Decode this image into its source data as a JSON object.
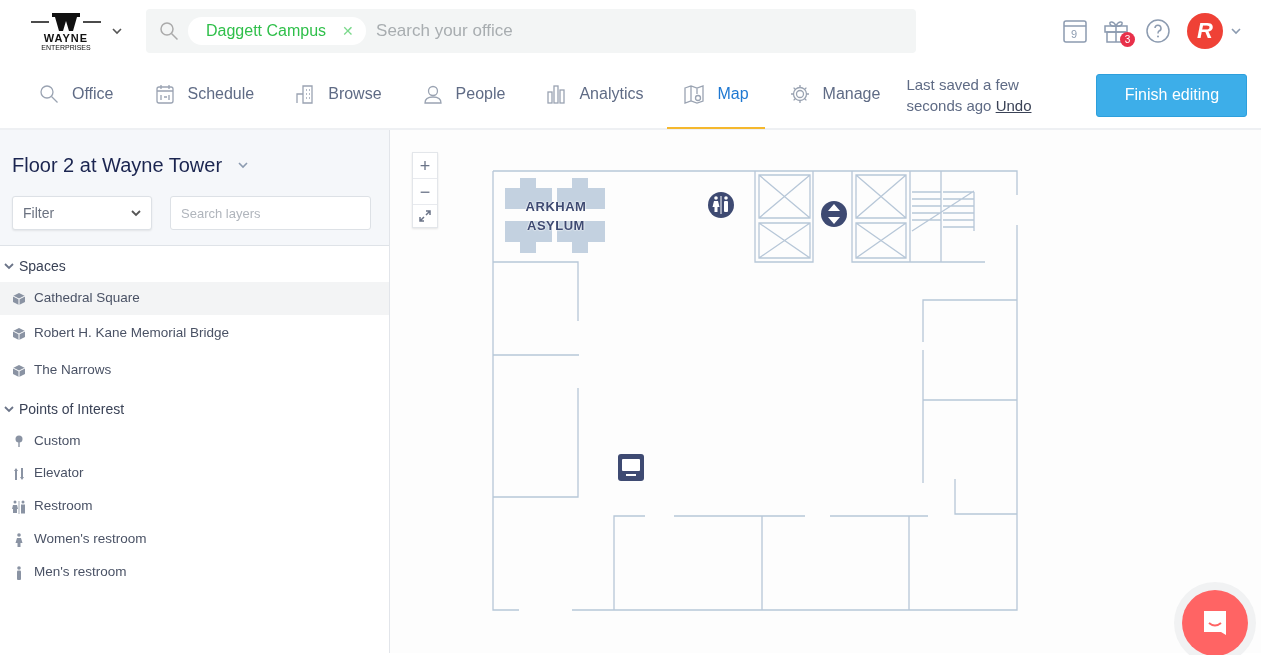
{
  "header": {
    "logo": {
      "name": "WAYNE",
      "tagline": "ENTERPRISES"
    },
    "search": {
      "chip": "Daggett Campus",
      "chip_remove": "✕",
      "placeholder": "Search your office"
    },
    "calendar_day": "9",
    "gift_count": "3",
    "avatar_letter": "R"
  },
  "nav": {
    "tabs": [
      {
        "label": "Office",
        "kind": "search",
        "selected": false
      },
      {
        "label": "Schedule",
        "kind": "calendar",
        "selected": false
      },
      {
        "label": "Browse",
        "kind": "building",
        "selected": false
      },
      {
        "label": "People",
        "kind": "person",
        "selected": false
      },
      {
        "label": "Analytics",
        "kind": "bars",
        "selected": false
      },
      {
        "label": "Map",
        "kind": "map",
        "selected": true
      },
      {
        "label": "Manage",
        "kind": "gear",
        "selected": false
      }
    ],
    "save_status": "Last saved a few seconds ago",
    "undo": "Undo",
    "finish_button": "Finish editing"
  },
  "sidebar": {
    "title": "Floor 2 at Wayne Tower",
    "filter": {
      "value": "Filter"
    },
    "search": {
      "placeholder": "Search layers"
    },
    "groups": [
      {
        "label": "Spaces",
        "expanded": true,
        "children": [
          {
            "label": "Cathedral Square",
            "kind": "space",
            "selected": true
          },
          {
            "label": "Robert H. Kane Memorial Bridge",
            "kind": "space",
            "selected": false
          },
          {
            "label": "The Narrows",
            "kind": "space",
            "selected": false
          }
        ]
      },
      {
        "label": "Points of Interest",
        "expanded": true,
        "children": [
          {
            "label": "Custom",
            "kind": "pin",
            "selected": false
          },
          {
            "label": "Elevator",
            "kind": "elevator",
            "selected": false
          },
          {
            "label": "Restroom",
            "kind": "restroom",
            "selected": false
          },
          {
            "label": "Women's restroom",
            "kind": "women",
            "selected": false
          },
          {
            "label": "Men's restroom",
            "kind": "men",
            "selected": false
          }
        ]
      }
    ]
  },
  "map": {
    "zoom_in": "+",
    "zoom_out": "−",
    "label": "ARKHAM ASYLUM"
  }
}
